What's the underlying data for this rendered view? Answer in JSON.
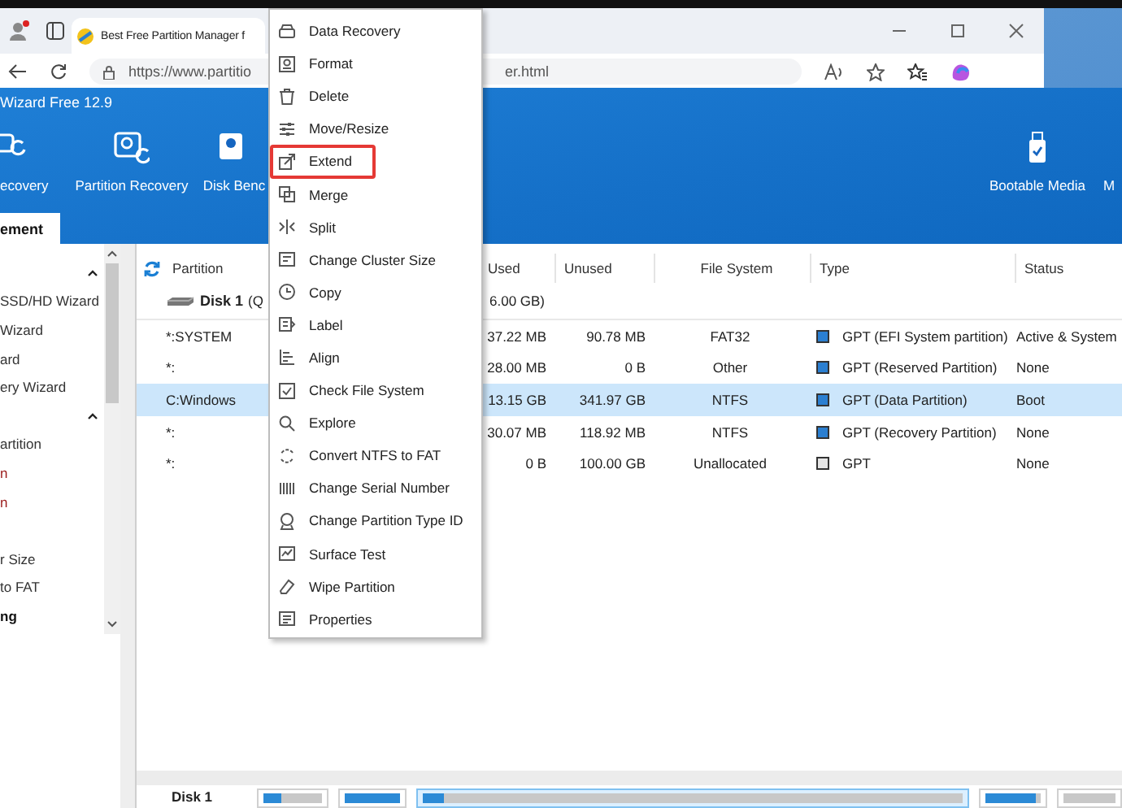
{
  "browser": {
    "tab_title": "Best Free Partition Manager f",
    "url_start": "https://www.partitio",
    "url_end": "er.html"
  },
  "app": {
    "title": "Wizard Free 12.9",
    "toolbar": [
      {
        "label": "ecovery"
      },
      {
        "label": "Partition Recovery"
      },
      {
        "label": "Disk Benc"
      }
    ],
    "toolbar_right": [
      {
        "label": "Bootable Media"
      },
      {
        "label": "M"
      }
    ],
    "tab": {
      "label": "ement",
      "selected": true
    }
  },
  "sidebar": [
    {
      "kind": "caret"
    },
    {
      "kind": "item",
      "label": "SSD/HD Wizard"
    },
    {
      "kind": "item",
      "label": "Wizard"
    },
    {
      "kind": "item",
      "label": "ard"
    },
    {
      "kind": "item",
      "label": "ery Wizard"
    },
    {
      "kind": "caret"
    },
    {
      "kind": "item",
      "label": "artition"
    },
    {
      "kind": "alert",
      "label": "n"
    },
    {
      "kind": "alert",
      "label": "n"
    },
    {
      "kind": "blank"
    },
    {
      "kind": "item",
      "label": "r Size"
    },
    {
      "kind": "item",
      "label": "to FAT"
    },
    {
      "kind": "heading",
      "label": "ng"
    }
  ],
  "table": {
    "columns": [
      "Partition",
      "Used",
      "Unused",
      "File System",
      "Type",
      "Status"
    ],
    "disk": {
      "name": "Disk 1",
      "info_start": "(Q",
      "info_end": "6.00 GB)"
    },
    "rows": [
      {
        "partition": "*:SYSTEM",
        "used": "37.22 MB",
        "unused": "90.78 MB",
        "file_system": "FAT32",
        "type": "GPT (EFI System partition)",
        "color": "#2b7fd1",
        "status": "Active & System",
        "selected": false
      },
      {
        "partition": "*:",
        "used": "28.00 MB",
        "unused": "0 B",
        "file_system": "Other",
        "type": "GPT (Reserved Partition)",
        "color": "#2b7fd1",
        "status": "None",
        "selected": false
      },
      {
        "partition": "C:Windows",
        "used": "13.15 GB",
        "unused": "341.97 GB",
        "file_system": "NTFS",
        "type": "GPT (Data Partition)",
        "color": "#2b7fd1",
        "status": "Boot",
        "selected": true
      },
      {
        "partition": "*:",
        "used": "30.07 MB",
        "unused": "118.92 MB",
        "file_system": "NTFS",
        "type": "GPT (Recovery Partition)",
        "color": "#2b7fd1",
        "status": "None",
        "selected": false
      },
      {
        "partition": "*:",
        "used": "0 B",
        "unused": "100.00 GB",
        "file_system": "Unallocated",
        "type": "GPT",
        "color": "#e6e6e6",
        "status": "None",
        "selected": false
      }
    ]
  },
  "disk_map": {
    "label": "Disk 1",
    "blocks": [
      {
        "level": 0.3,
        "selected": false
      },
      {
        "level": 1,
        "selected": false
      },
      {
        "level": 0.04,
        "selected": true
      },
      {
        "level": 0.9,
        "selected": false
      },
      {
        "selected": false
      }
    ]
  },
  "context_menu": {
    "items": [
      {
        "label": "Data Recovery",
        "highlighted": false
      },
      {
        "label": "Format",
        "highlighted": false
      },
      {
        "label": "Delete",
        "highlighted": false
      },
      {
        "label": "Move/Resize",
        "highlighted": false
      },
      {
        "label": "Extend",
        "highlighted": true
      },
      {
        "label": "Merge",
        "highlighted": false
      },
      {
        "label": "Split",
        "highlighted": false
      },
      {
        "label": "Change Cluster Size",
        "highlighted": false
      },
      {
        "label": "Copy",
        "highlighted": false
      },
      {
        "label": "Label",
        "highlighted": false
      },
      {
        "label": "Align",
        "highlighted": false
      },
      {
        "label": "Check File System",
        "highlighted": false
      },
      {
        "label": "Explore",
        "highlighted": false
      },
      {
        "label": "Convert NTFS to FAT",
        "highlighted": false
      },
      {
        "label": "Change Serial Number",
        "highlighted": false
      },
      {
        "label": "Change Partition Type ID",
        "highlighted": false
      },
      {
        "label": "Surface Test",
        "highlighted": false
      },
      {
        "label": "Wipe Partition",
        "highlighted": false
      },
      {
        "label": "Properties",
        "highlighted": false
      }
    ]
  }
}
